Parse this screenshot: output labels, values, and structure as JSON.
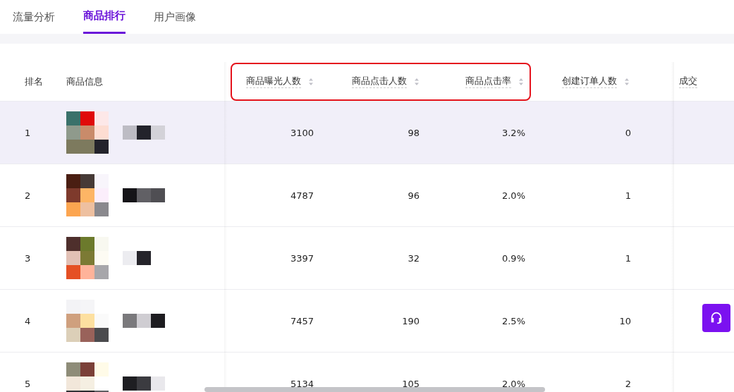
{
  "tabs": [
    {
      "label": "流量分析",
      "selected": false
    },
    {
      "label": "商品排行",
      "selected": true
    },
    {
      "label": "用户画像",
      "selected": false
    }
  ],
  "table": {
    "columns": [
      {
        "kind": "column",
        "label": "排名",
        "sortable": false
      },
      {
        "kind": "column",
        "label": "商品信息",
        "sortable": false
      },
      {
        "kind": "frame",
        "columns": [
          {
            "label": "商品曝光人数",
            "sortable": true
          },
          {
            "label": "商品点击人数",
            "sortable": true
          },
          {
            "label": "商品点击率",
            "sortable": true
          }
        ]
      },
      {
        "kind": "column",
        "label": "创建订单人数",
        "sortable": true
      },
      {
        "kind": "column",
        "label": "成交",
        "sortable": false
      }
    ],
    "rows": [
      {
        "rank": "1",
        "exposure": "3100",
        "clicks": "98",
        "ctr": "3.2%",
        "orders": "0",
        "selected": true
      },
      {
        "rank": "2",
        "exposure": "4787",
        "clicks": "96",
        "ctr": "2.0%",
        "orders": "1",
        "selected": false
      },
      {
        "rank": "3",
        "exposure": "3397",
        "clicks": "32",
        "ctr": "0.9%",
        "orders": "1",
        "selected": false
      },
      {
        "rank": "4",
        "exposure": "7457",
        "clicks": "190",
        "ctr": "2.5%",
        "orders": "10",
        "selected": false
      },
      {
        "rank": "5",
        "exposure": "5134",
        "clicks": "105",
        "ctr": "2.0%",
        "orders": "2",
        "selected": false
      }
    ]
  }
}
